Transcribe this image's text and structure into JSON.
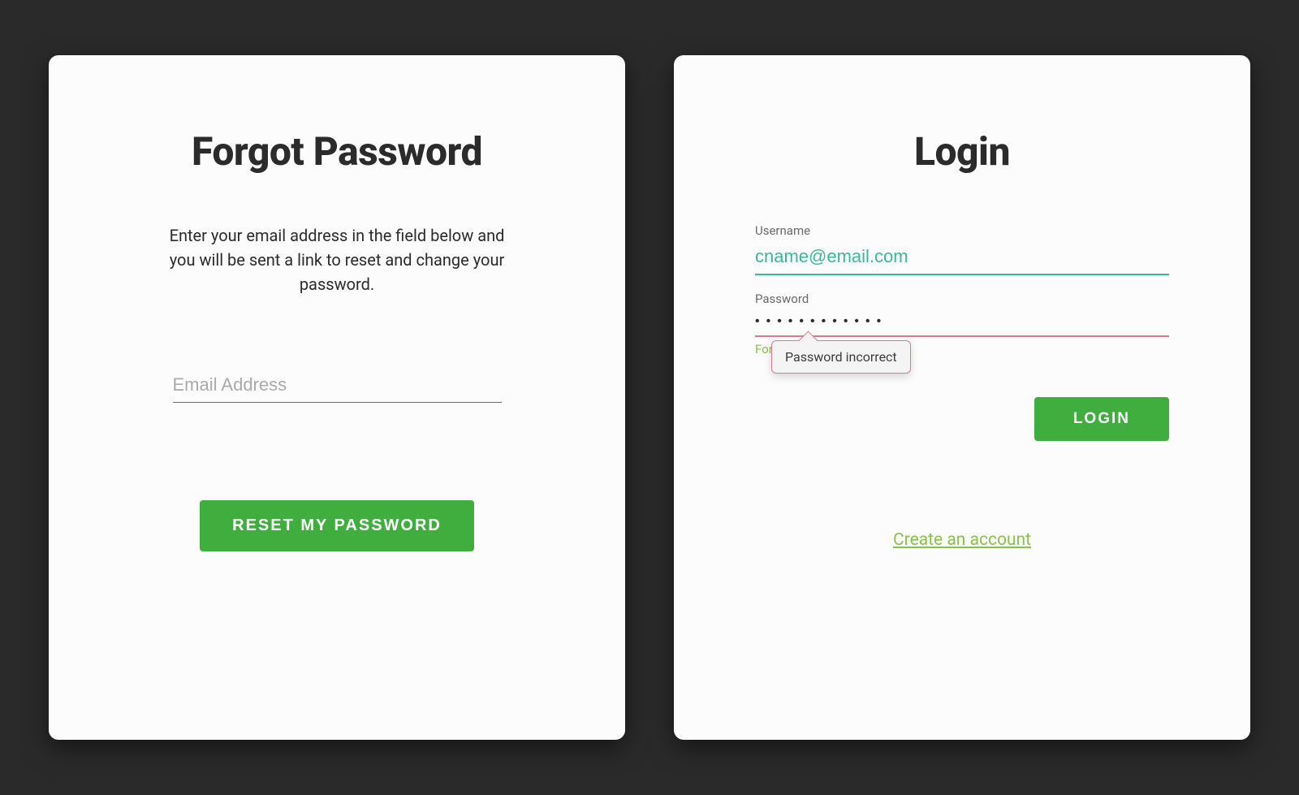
{
  "forgot": {
    "title": "Forgot Password",
    "description": "Enter your email address in the field below and you will be sent a link to reset and change your password.",
    "email_placeholder": "Email Address",
    "email_value": "",
    "button_label": "RESET MY PASSWORD"
  },
  "login": {
    "title": "Login",
    "username_label": "Username",
    "username_value": "cname@email.com",
    "password_label": "Password",
    "password_value": "••••••••••••",
    "error_tooltip": "Password incorrect",
    "forgot_link": "Forgot password?",
    "button_label": "LOGIN",
    "create_link": "Create an account"
  },
  "colors": {
    "accent_green": "#3fae3f",
    "teal": "#3bb79a",
    "link_green": "#8ac24a",
    "error": "#d07f8f"
  }
}
